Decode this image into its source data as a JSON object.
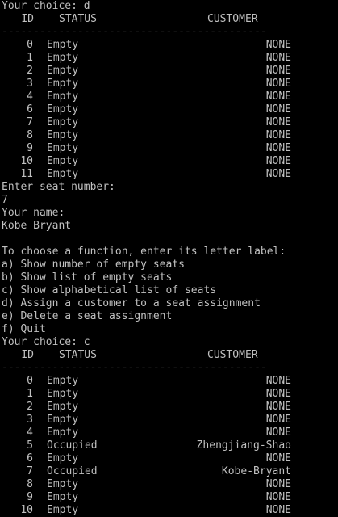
{
  "console": {
    "prompt1": "Your choice: d",
    "header": {
      "id": "ID",
      "status": "STATUS",
      "customer": "CUSTOMER"
    },
    "separator": "------------------------------------------",
    "table1": [
      {
        "id": "0",
        "status": "Empty",
        "customer": "NONE"
      },
      {
        "id": "1",
        "status": "Empty",
        "customer": "NONE"
      },
      {
        "id": "2",
        "status": "Empty",
        "customer": "NONE"
      },
      {
        "id": "3",
        "status": "Empty",
        "customer": "NONE"
      },
      {
        "id": "4",
        "status": "Empty",
        "customer": "NONE"
      },
      {
        "id": "6",
        "status": "Empty",
        "customer": "NONE"
      },
      {
        "id": "7",
        "status": "Empty",
        "customer": "NONE"
      },
      {
        "id": "8",
        "status": "Empty",
        "customer": "NONE"
      },
      {
        "id": "9",
        "status": "Empty",
        "customer": "NONE"
      },
      {
        "id": "10",
        "status": "Empty",
        "customer": "NONE"
      },
      {
        "id": "11",
        "status": "Empty",
        "customer": "NONE"
      }
    ],
    "seat_prompt": "Enter seat number:",
    "seat_value": "7",
    "name_prompt": "Your name:",
    "name_value": "Kobe Bryant",
    "menu_intro": "To choose a function, enter its letter label:",
    "menu": [
      "a) Show number of empty seats",
      "b) Show list of empty seats",
      "c) Show alphabetical list of seats",
      "d) Assign a customer to a seat assignment",
      "e) Delete a seat assignment",
      "f) Quit"
    ],
    "prompt2": "Your choice: c",
    "table2": [
      {
        "id": "0",
        "status": "Empty",
        "customer": "NONE"
      },
      {
        "id": "1",
        "status": "Empty",
        "customer": "NONE"
      },
      {
        "id": "2",
        "status": "Empty",
        "customer": "NONE"
      },
      {
        "id": "3",
        "status": "Empty",
        "customer": "NONE"
      },
      {
        "id": "4",
        "status": "Empty",
        "customer": "NONE"
      },
      {
        "id": "5",
        "status": "Occupied",
        "customer": "Zhengjiang-Shao"
      },
      {
        "id": "6",
        "status": "Empty",
        "customer": "NONE"
      },
      {
        "id": "7",
        "status": "Occupied",
        "customer": "Kobe-Bryant"
      },
      {
        "id": "8",
        "status": "Empty",
        "customer": "NONE"
      },
      {
        "id": "9",
        "status": "Empty",
        "customer": "NONE"
      },
      {
        "id": "10",
        "status": "Empty",
        "customer": "NONE"
      }
    ]
  }
}
